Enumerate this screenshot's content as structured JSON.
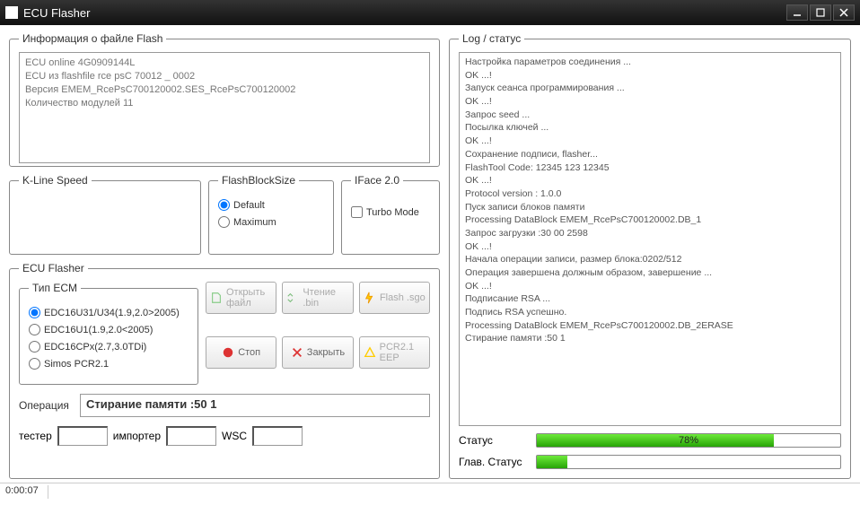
{
  "window": {
    "title": "ECU Flasher"
  },
  "info": {
    "legend": "Информация  о файле Flash",
    "lines": [
      "ECU online 4G0909144L",
      "ECU из flashfile rce psC 70012 _ 0002",
      "Версия EMEM_RcePsC700120002.SES_RcePsC700120002",
      "Количество модулей 11"
    ]
  },
  "kline": {
    "legend": "K-Line Speed"
  },
  "flashblock": {
    "legend": "FlashBlockSize",
    "opt1": "Default",
    "opt2": "Maximum"
  },
  "iface": {
    "legend": "IFace 2.0",
    "opt": "Turbo Mode"
  },
  "ecuflasher": {
    "legend": "ECU Flasher"
  },
  "ecm": {
    "legend": "Тип ECM",
    "opts": [
      "EDC16U31/U34(1.9,2.0>2005)",
      "EDC16U1(1.9,2.0<2005)",
      "EDC16CPx(2.7,3.0TDi)",
      "Simos PCR2.1"
    ]
  },
  "buttons": {
    "open": "Открыть файл",
    "read": "Чтение .bin",
    "flash": "Flash .sgo",
    "stop": "Стоп",
    "close": "Закрыть",
    "pcr": "PCR2.1 EEP"
  },
  "operation": {
    "label": "Операция",
    "value": "Стирание памяти :50 1"
  },
  "bottom": {
    "tester": "тестер",
    "importer": "импортер",
    "wsc": "WSC"
  },
  "log": {
    "legend": "Log / статус",
    "lines": [
      "Настройка параметров соединения ...",
      "OK ...!",
      "Запуск сеанса программирования ...",
      "OK ...!",
      "Запрос seed ...",
      "Посылка ключей ...",
      "OK ...!",
      "Сохранение подписи, flasher...",
      "FlashTool Code: 12345 123 12345",
      "OK ...!",
      "Protocol version : 1.0.0",
      "Пуск записи блоков памяти",
      "Processing DataBlock EMEM_RcePsC700120002.DB_1",
      "Запрос загрузки :30 00 2598",
      "OK ...!",
      "Начала операции записи, размер блока:0202/512",
      "Операция завершена должным образом, завершение ...",
      "OK ...!",
      "Подписание RSA ...",
      "Подпись RSA успешно.",
      "Processing DataBlock EMEM_RcePsC700120002.DB_2ERASE",
      "Стирание памяти :50 1"
    ]
  },
  "status": {
    "label": "Статус",
    "pct": "78%"
  },
  "mainstatus": {
    "label": "Глав. Статус"
  },
  "footer": {
    "time": "0:00:07"
  }
}
